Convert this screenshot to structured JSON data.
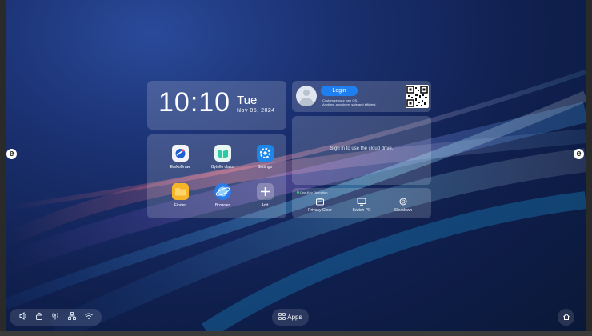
{
  "clock": {
    "time": "10:10",
    "weekday": "Tue",
    "date": "Nov 05, 2024"
  },
  "account": {
    "login_label": "Login",
    "tagline_1": "Customize your own OS,",
    "tagline_2": "Anytime, anywhere, safe and efficient."
  },
  "cloud": {
    "sign_in_text": "Sign in to use the cloud drive."
  },
  "one_key": {
    "title": "One-Key Operation",
    "items": [
      {
        "label": "Privacy Clear",
        "icon": "privacy-clear-icon"
      },
      {
        "label": "Switch PC",
        "icon": "switch-pc-icon"
      },
      {
        "label": "Shutdown",
        "icon": "shutdown-icon"
      }
    ]
  },
  "apps": [
    {
      "label": "EmkoDraw",
      "icon": "emkodraw-icon",
      "color": "#f2f4f8"
    },
    {
      "label": "Bytello class",
      "icon": "bytello-class-icon",
      "color": "#e7f6f2"
    },
    {
      "label": "Settings",
      "icon": "settings-icon",
      "color": "#1e86e8"
    },
    {
      "label": "Finder",
      "icon": "finder-icon",
      "color": "#f6b429"
    },
    {
      "label": "Browser",
      "icon": "browser-icon",
      "color": "#2d7be6"
    },
    {
      "label": "Add",
      "icon": "add-icon",
      "color": "#ffffff"
    }
  ],
  "taskbar": {
    "apps_label": "Apps",
    "icons": [
      "volume-icon",
      "lock-icon",
      "signal-icon",
      "network-icon",
      "wifi-icon"
    ]
  },
  "side": {
    "left_glyph": "e",
    "right_glyph": "e"
  }
}
